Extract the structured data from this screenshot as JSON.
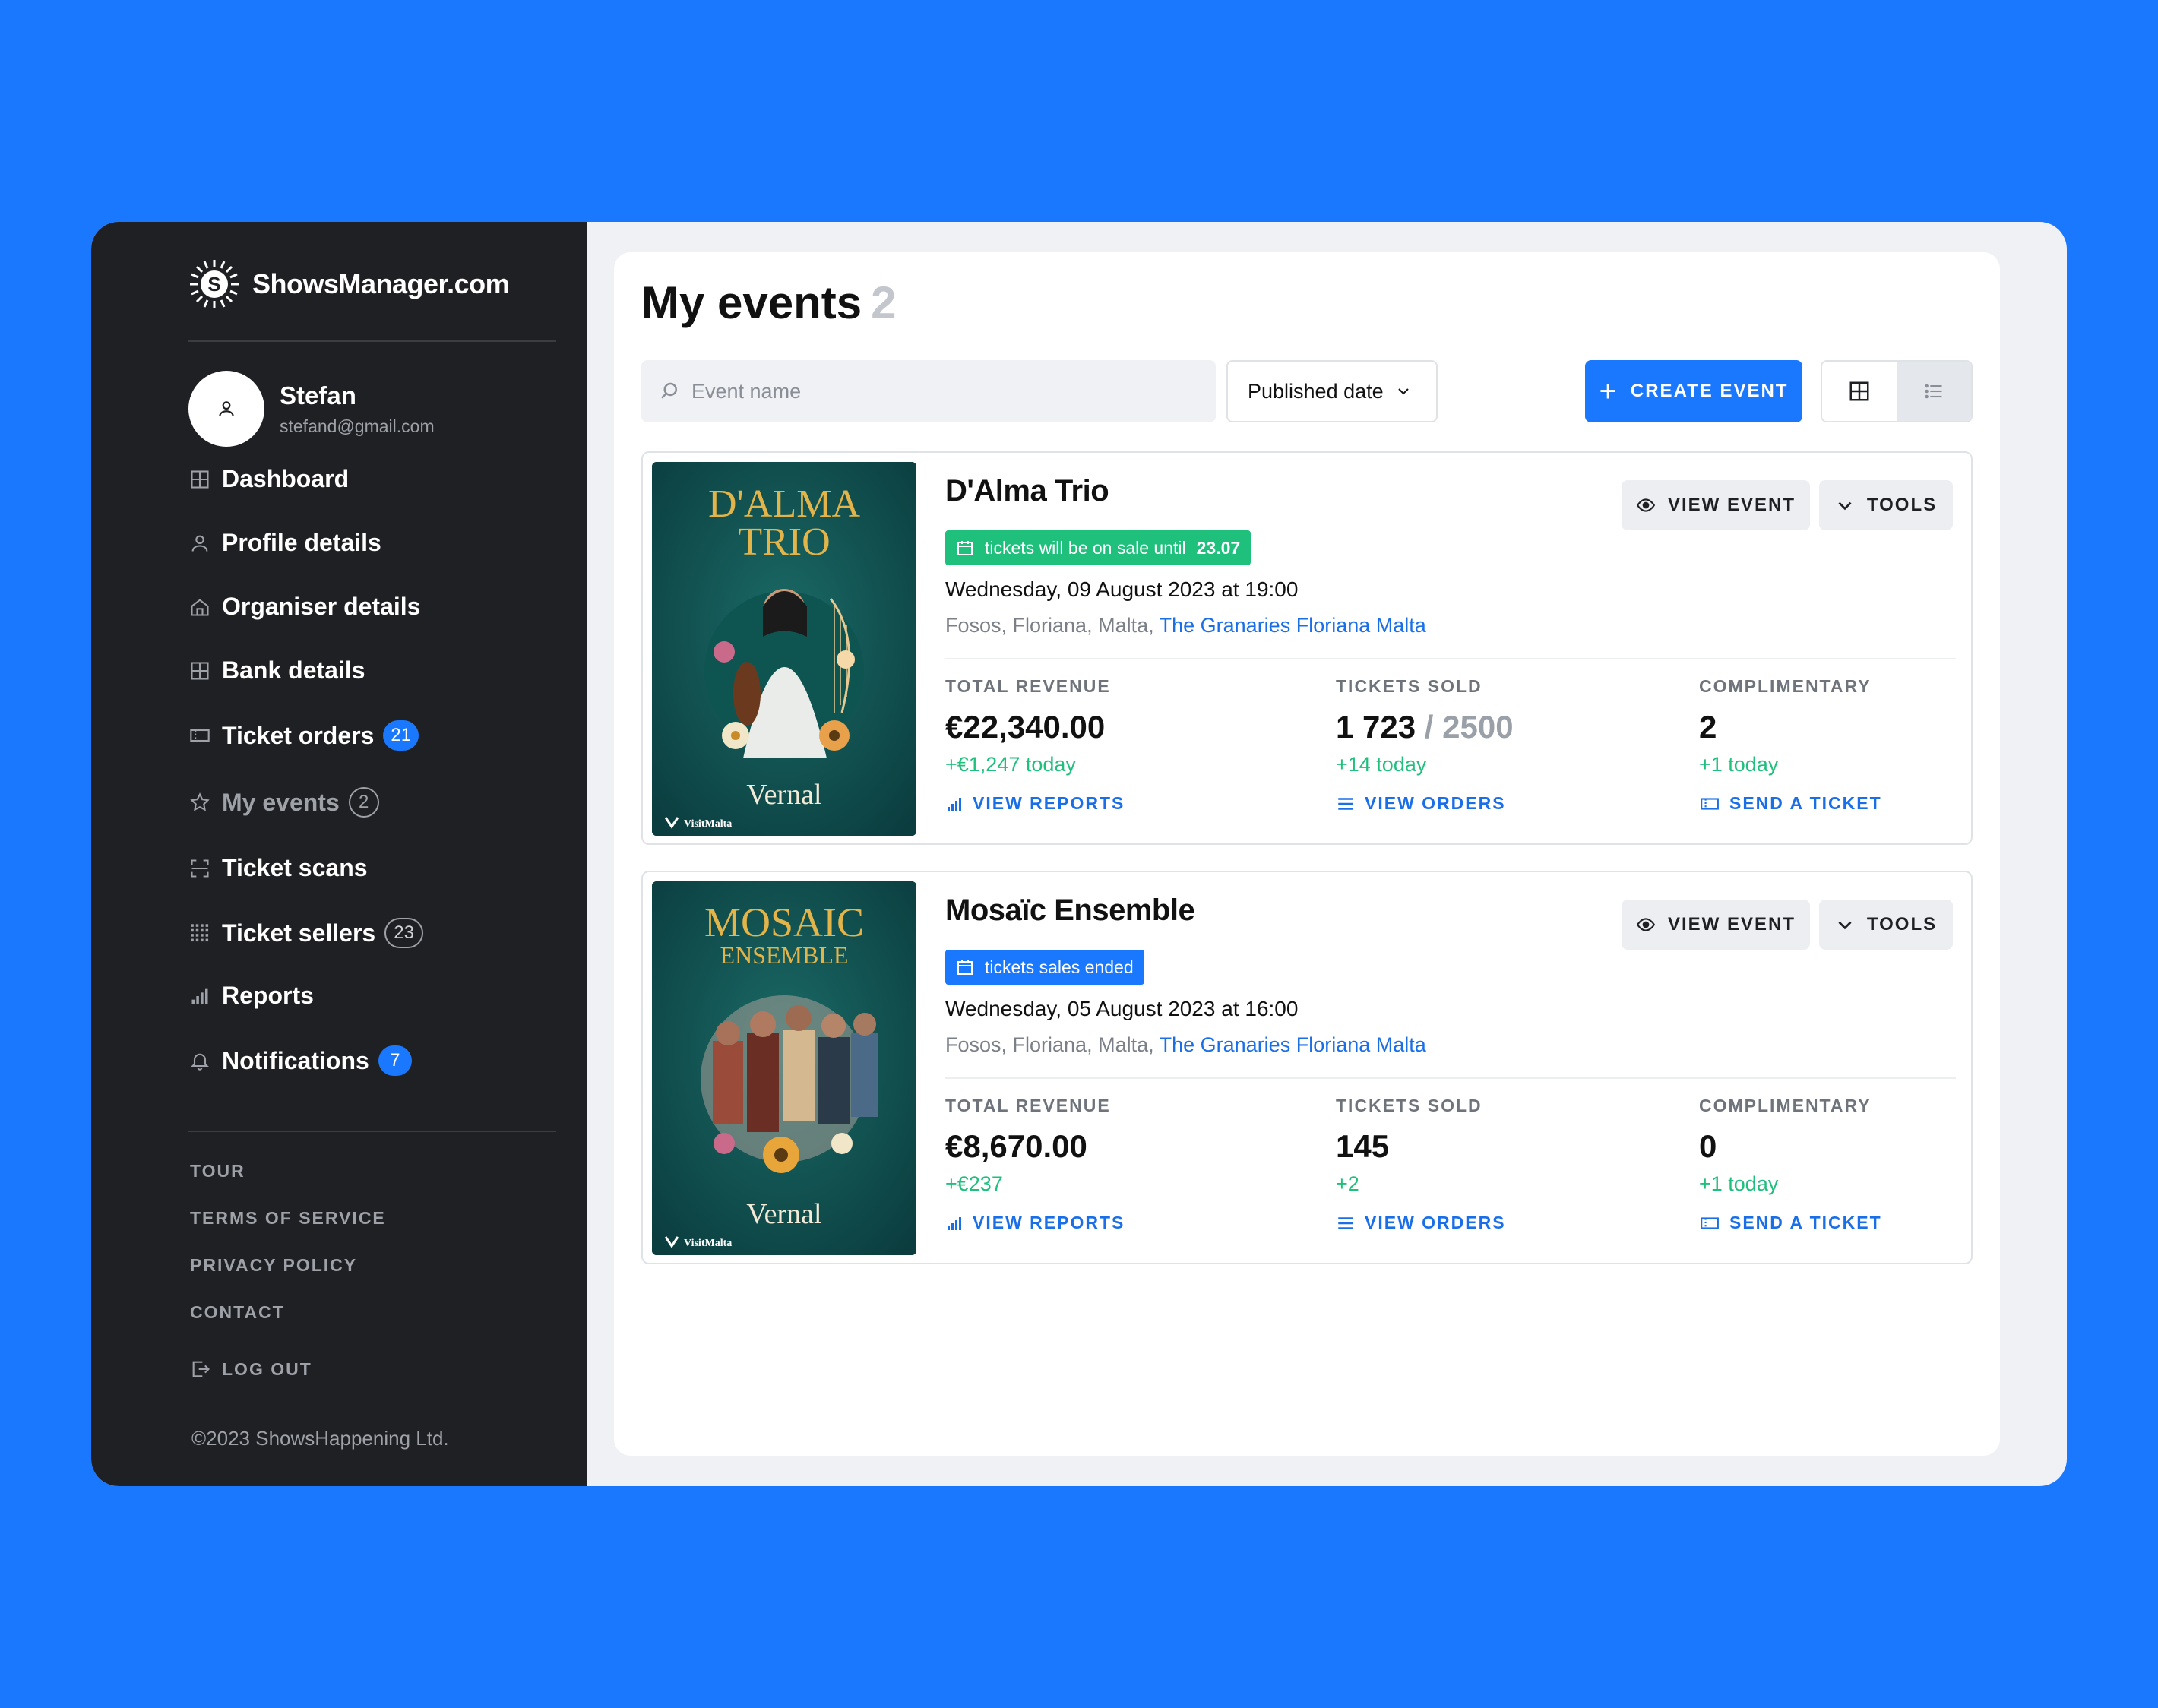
{
  "brand": {
    "name": "ShowsManager.com"
  },
  "user": {
    "name": "Stefan",
    "email": "stefand@gmail.com"
  },
  "nav": [
    {
      "label": "Dashboard",
      "icon": "grid-icon",
      "badge": null
    },
    {
      "label": "Profile details",
      "icon": "user-icon",
      "badge": null
    },
    {
      "label": "Organiser details",
      "icon": "home-icon",
      "badge": null
    },
    {
      "label": "Bank details",
      "icon": "table-icon",
      "badge": null
    },
    {
      "label": "Ticket orders",
      "icon": "ticket-icon",
      "badge": "21"
    },
    {
      "label": "My events",
      "icon": "star-icon",
      "badge": "2"
    },
    {
      "label": "Ticket scans",
      "icon": "scan-icon",
      "badge": null
    },
    {
      "label": "Ticket sellers",
      "icon": "dots-grid-icon",
      "badge": "23"
    },
    {
      "label": "Reports",
      "icon": "bar-chart-icon",
      "badge": null
    },
    {
      "label": "Notifications",
      "icon": "bell-icon",
      "badge": "7"
    }
  ],
  "footer_links": [
    "TOUR",
    "TERMS OF SERVICE",
    "PRIVACY POLICY",
    "CONTACT"
  ],
  "logout_label": "LOG OUT",
  "copyright": "©2023 ShowsHappening Ltd.",
  "page": {
    "title": "My events",
    "count": "2",
    "search_placeholder": "Event name",
    "sort_label": "Published date",
    "create_label": "CREATE EVENT"
  },
  "colors": {
    "accent": "#1a78ff",
    "sidebar": "#1f2023",
    "positive": "#1fbf7c",
    "on_sale": "#1fbf7c"
  },
  "events": [
    {
      "title": "D'Alma Trio",
      "poster_title_1": "D'ALMA",
      "poster_title_2": "TRIO",
      "status_text": "tickets will be on sale until",
      "status_date": "23.07",
      "status_kind": "on-sale",
      "datetime": "Wednesday, 09 August 2023 at 19:00",
      "location_prefix": "Fosos, Floriana, Malta,",
      "venue": "The Granaries Floriana Malta",
      "view_label": "VIEW EVENT",
      "tools_label": "TOOLS",
      "revenue_label": "TOTAL REVENUE",
      "revenue_value": "€22,340.00",
      "revenue_delta": "+€1,247 today",
      "revenue_link": "VIEW REPORTS",
      "sold_label": "TICKETS SOLD",
      "sold_value": "1 723",
      "sold_total": "/ 2500",
      "sold_delta": "+14 today",
      "sold_link": "VIEW ORDERS",
      "comp_label": "COMPLIMENTARY",
      "comp_value": "2",
      "comp_delta": "+1 today",
      "comp_link": "SEND A TICKET"
    },
    {
      "title": "Mosaïc Ensemble",
      "poster_title_1": "MOSAIC",
      "poster_title_2": "ENSEMBLE",
      "status_text": "tickets sales ended",
      "status_date": "",
      "status_kind": "ended",
      "datetime": "Wednesday, 05 August 2023 at 16:00",
      "location_prefix": "Fosos, Floriana, Malta,",
      "venue": "The Granaries Floriana Malta",
      "view_label": "VIEW EVENT",
      "tools_label": "TOOLS",
      "revenue_label": "TOTAL REVENUE",
      "revenue_value": "€8,670.00",
      "revenue_delta": "+€237",
      "revenue_link": "VIEW REPORTS",
      "sold_label": "TICKETS SOLD",
      "sold_value": "145",
      "sold_total": "",
      "sold_delta": "+2",
      "sold_link": "VIEW ORDERS",
      "comp_label": "COMPLIMENTARY",
      "comp_value": "0",
      "comp_delta": "+1 today",
      "comp_link": "SEND A TICKET"
    }
  ],
  "poster_common": {
    "brand": "Vernal",
    "sponsor": "VisitMalta"
  }
}
